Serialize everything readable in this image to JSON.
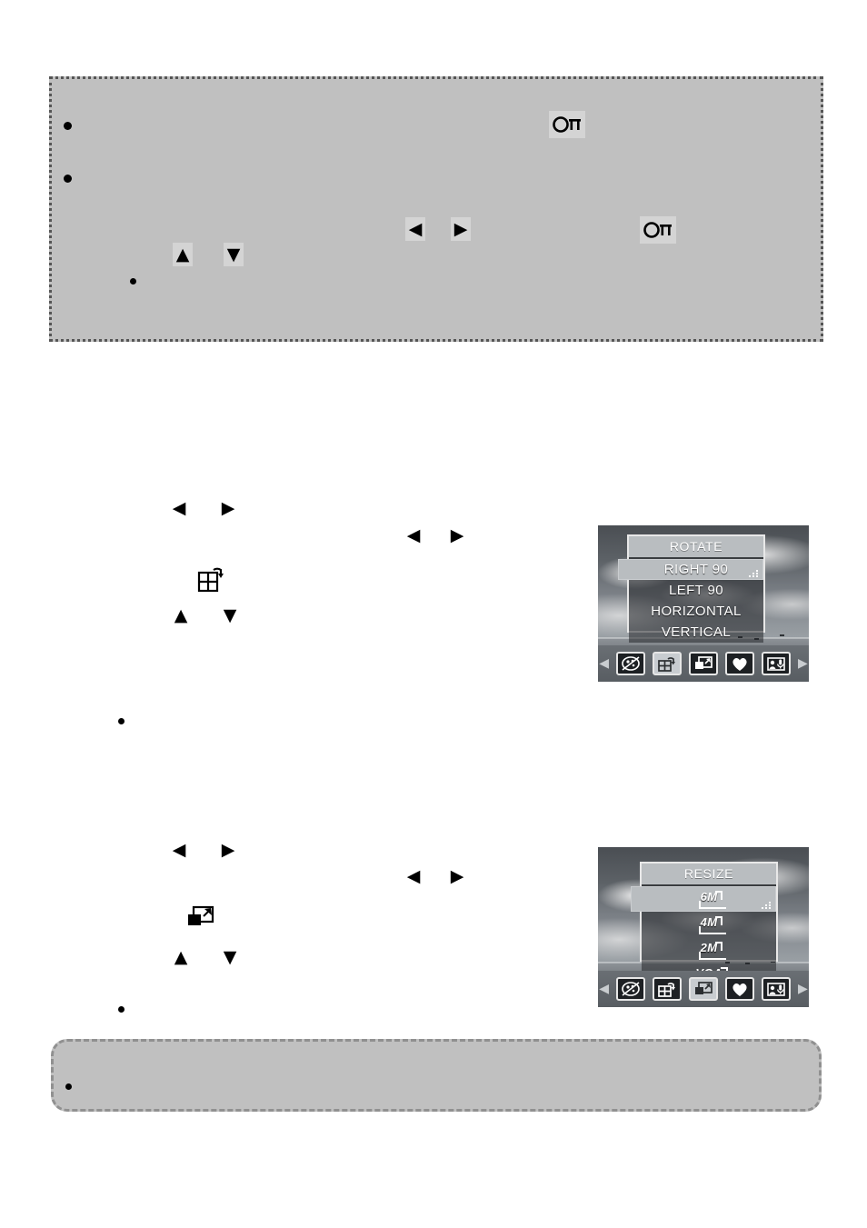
{
  "page": {
    "background_color": "#ffffff",
    "box_fill_color": "#c0c0c0"
  },
  "top_note_box": {
    "border_style": "dotted",
    "bullets": [
      {
        "name": "note-bullet-1"
      },
      {
        "name": "note-bullet-2"
      },
      {
        "name": "note-sub-bullet-1"
      }
    ],
    "key_glyphs": [
      {
        "name": "ok-button-glyph-1",
        "label": "OK"
      },
      {
        "name": "left-arrow-glyph",
        "label": "◀"
      },
      {
        "name": "right-arrow-glyph",
        "label": "▶"
      },
      {
        "name": "ok-button-glyph-2",
        "label": "OK"
      },
      {
        "name": "up-arrow-glyph",
        "label": "▲"
      },
      {
        "name": "down-arrow-glyph",
        "label": "▼"
      }
    ]
  },
  "rotate_section": {
    "key_glyphs": {
      "left": "◀",
      "right": "▶",
      "up": "▲",
      "down": "▼"
    },
    "menu_icon_name": "rotate-icon",
    "bullet_name": "rotate-note-bullet"
  },
  "resize_section": {
    "key_glyphs": {
      "left": "◀",
      "right": "▶",
      "up": "▲",
      "down": "▼"
    },
    "menu_icon_name": "resize-icon",
    "bullet_name": "resize-note-bullet"
  },
  "bottom_note_box": {
    "border_style": "dashed",
    "bullet_name": "bottom-note-bullet"
  },
  "lcd_rotate": {
    "menu_title": "ROTATE",
    "items": [
      {
        "label": "RIGHT 90",
        "selected": true
      },
      {
        "label": "LEFT 90",
        "selected": false
      },
      {
        "label": "HORIZONTAL",
        "selected": false
      },
      {
        "label": "VERTICAL",
        "selected": false
      }
    ],
    "toolbar": {
      "left_arrow": "◀",
      "right_arrow": "▶",
      "icons": [
        {
          "name": "effect-palette-icon",
          "active": false
        },
        {
          "name": "rotate-icon",
          "active": true
        },
        {
          "name": "resize-icon",
          "active": false
        },
        {
          "name": "favorite-heart-icon",
          "active": false
        },
        {
          "name": "voice-memo-icon",
          "active": false
        }
      ]
    }
  },
  "lcd_resize": {
    "menu_title": "RESIZE",
    "items": [
      {
        "label": "6M",
        "selected": true
      },
      {
        "label": "4M",
        "selected": false
      },
      {
        "label": "2M",
        "selected": false
      },
      {
        "label": "VGA",
        "selected": false
      }
    ],
    "toolbar": {
      "left_arrow": "◀",
      "right_arrow": "▶",
      "icons": [
        {
          "name": "effect-palette-icon",
          "active": false
        },
        {
          "name": "rotate-icon",
          "active": false
        },
        {
          "name": "resize-icon",
          "active": true
        },
        {
          "name": "favorite-heart-icon",
          "active": false
        },
        {
          "name": "voice-memo-icon",
          "active": false
        }
      ]
    }
  }
}
